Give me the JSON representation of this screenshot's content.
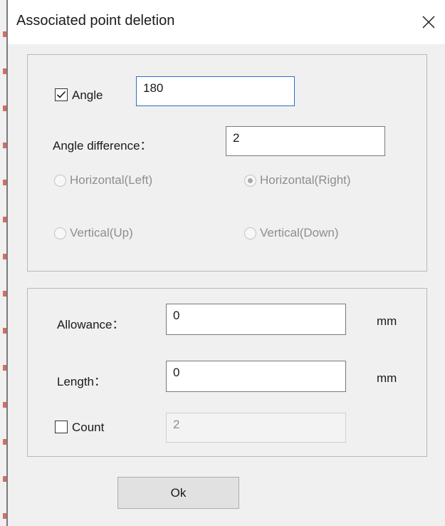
{
  "dialog": {
    "title": "Associated point deletion"
  },
  "angle_group": {
    "angle": {
      "label": "Angle",
      "checked": true,
      "value": "180"
    },
    "angle_difference": {
      "label": "Angle difference：",
      "value": "2"
    },
    "radios": {
      "horizontal_left": {
        "label": "Horizontal(Left)",
        "selected": false
      },
      "horizontal_right": {
        "label": "Horizontal(Right)",
        "selected": true
      },
      "vertical_up": {
        "label": "Vertical(Up)",
        "selected": false
      },
      "vertical_down": {
        "label": "Vertical(Down)",
        "selected": false
      }
    }
  },
  "length_group": {
    "allowance": {
      "label": "Allowance：",
      "value": "0",
      "unit": "mm"
    },
    "length": {
      "label": "Length：",
      "value": "0",
      "unit": "mm"
    },
    "count": {
      "label": "Count",
      "checked": false,
      "value": "2"
    }
  },
  "buttons": {
    "ok_label": "Ok"
  },
  "icons": {
    "close": "close-icon",
    "check": "checkmark-icon"
  },
  "colors": {
    "title_bar": "#ffffff",
    "dialog_bg": "#f0f0f0",
    "focus_border": "#2b6fc7",
    "disabled_text": "#8e8e8e"
  }
}
